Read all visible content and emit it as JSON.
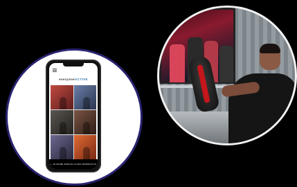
{
  "phone": {
    "brand_prefix": "everyone",
    "brand_suffix": "ACTIVE",
    "more_label": "+ 10 MORE WORLD CLASS WORKOUTS",
    "tiles": [
      {
        "label": "",
        "color": "#a33b35"
      },
      {
        "label": "",
        "color": "#4b5a7a"
      },
      {
        "label": "",
        "color": "#3d3a35"
      },
      {
        "label": "",
        "color": "#5a3b2e"
      },
      {
        "label": "",
        "color": "#4a4663"
      },
      {
        "label": "",
        "color": "#c3522b"
      }
    ]
  },
  "colors": {
    "phone_ring": "#2a2470",
    "gym_ring": "#f2f2f2",
    "background": "#000000"
  }
}
